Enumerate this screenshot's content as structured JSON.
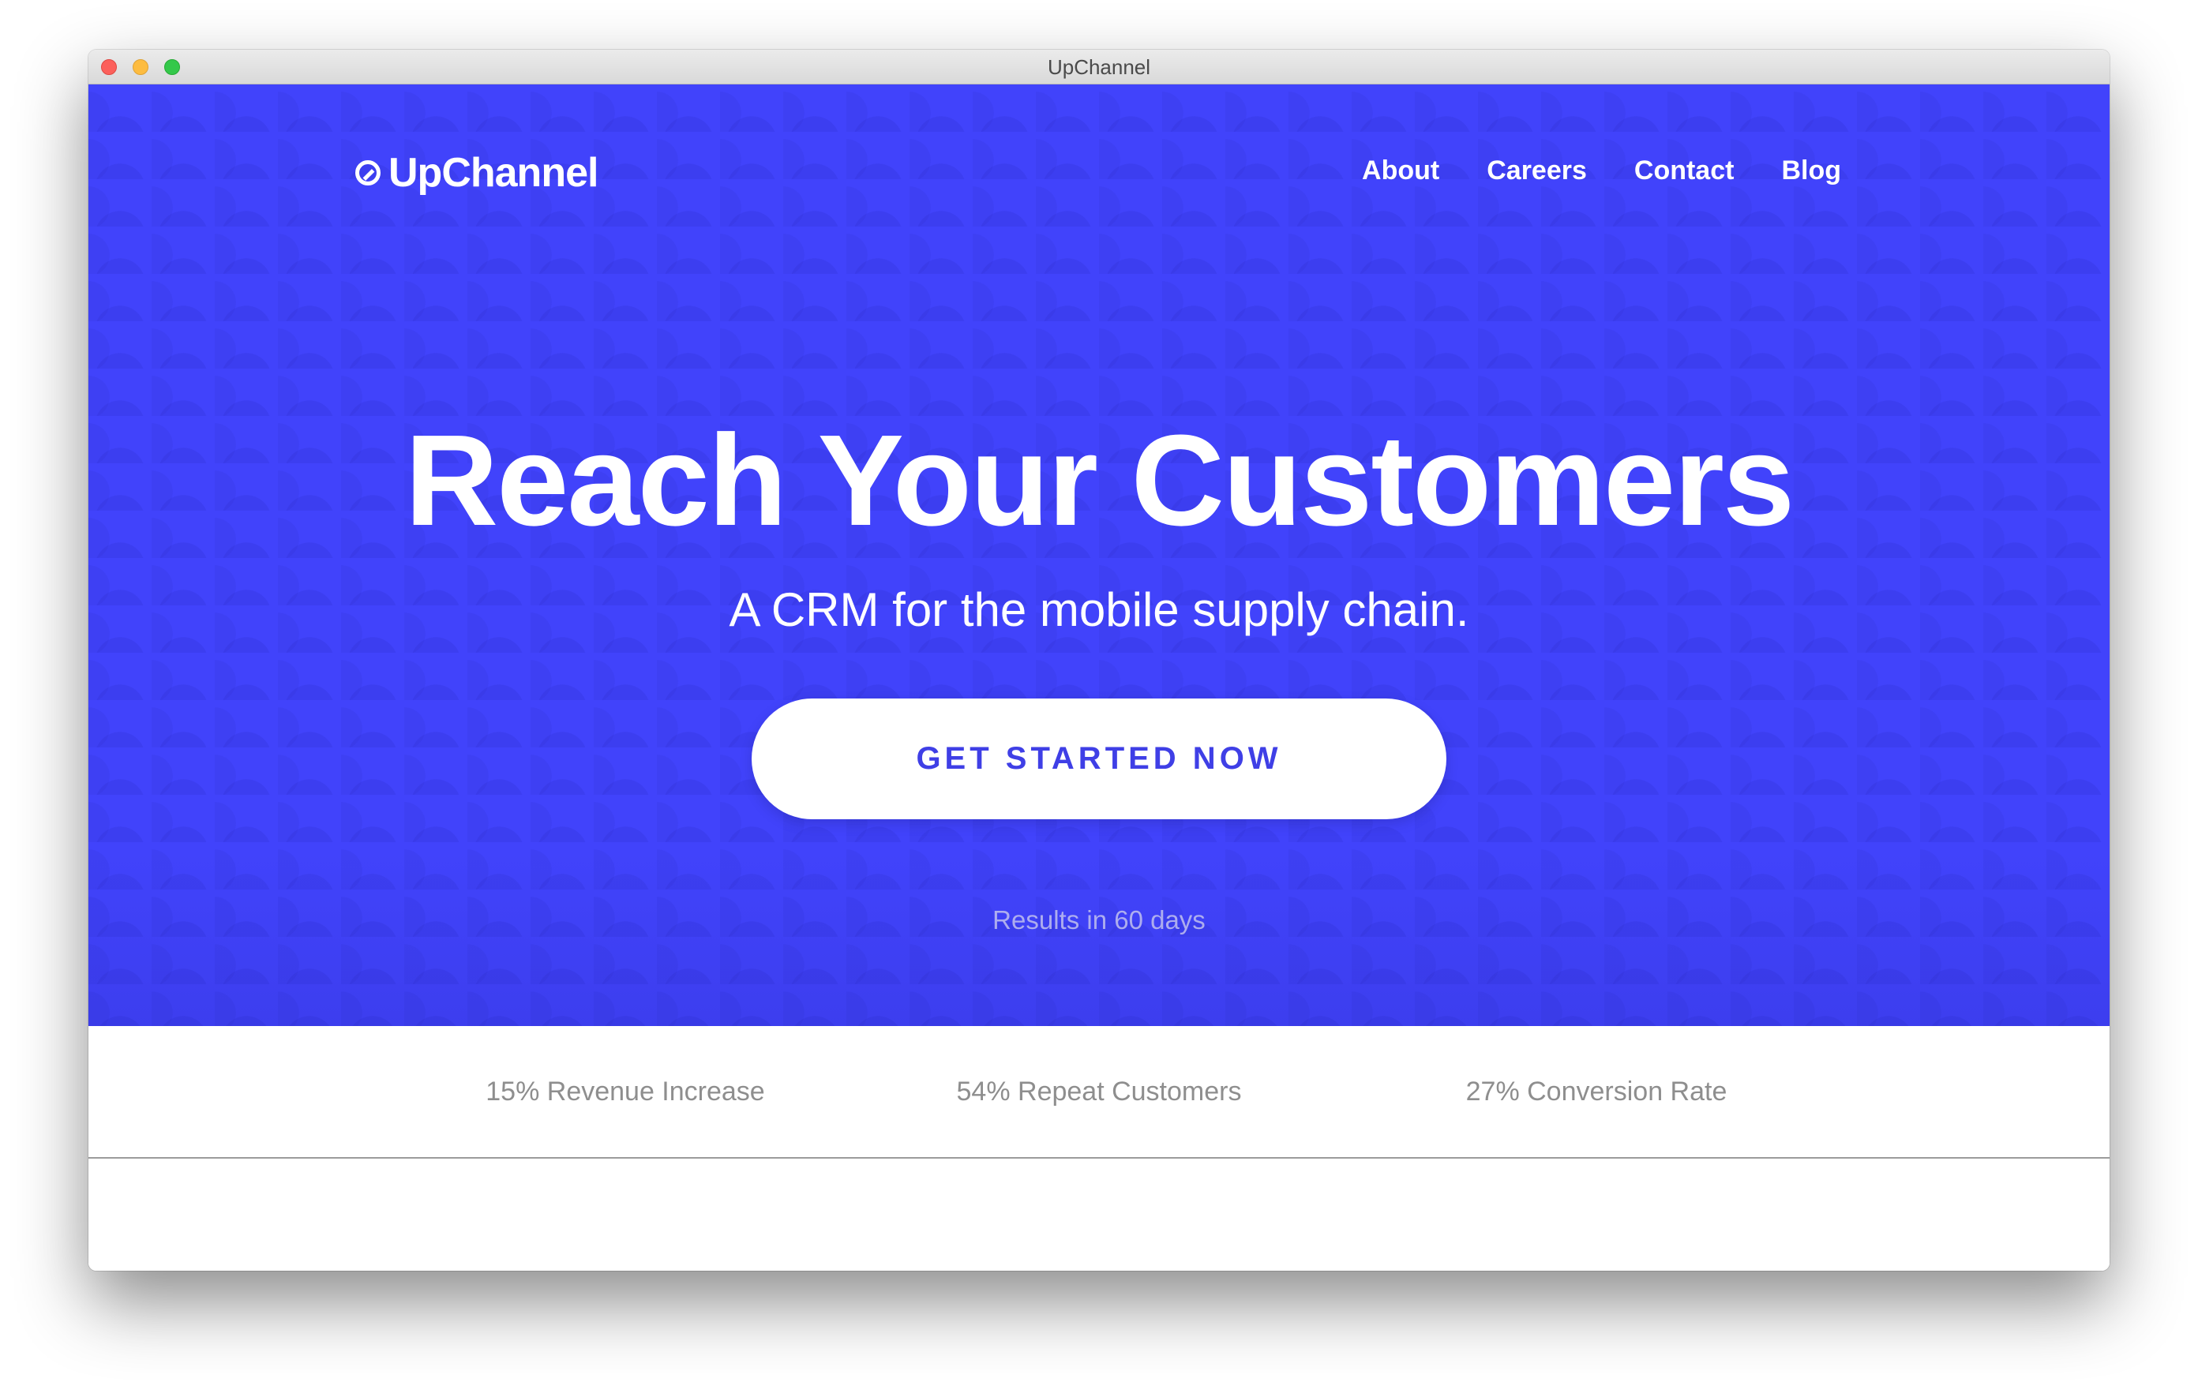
{
  "window": {
    "title": "UpChannel"
  },
  "header": {
    "logo_text": "UpChannel",
    "logo_icon": "upchannel-logo-icon",
    "nav": [
      {
        "label": "About"
      },
      {
        "label": "Careers"
      },
      {
        "label": "Contact"
      },
      {
        "label": "Blog"
      }
    ]
  },
  "hero": {
    "headline": "Reach Your Customers",
    "subheadline": "A CRM for the mobile supply chain.",
    "cta_label": "GET STARTED NOW",
    "note": "Results in 60 days"
  },
  "stats": [
    {
      "label": "15% Revenue Increase"
    },
    {
      "label": "54% Repeat Customers"
    },
    {
      "label": "27% Conversion Rate"
    }
  ],
  "colors": {
    "hero_background": "#4143fb",
    "cta_text": "#3f3fe6",
    "stat_text": "#8e8e8e"
  }
}
